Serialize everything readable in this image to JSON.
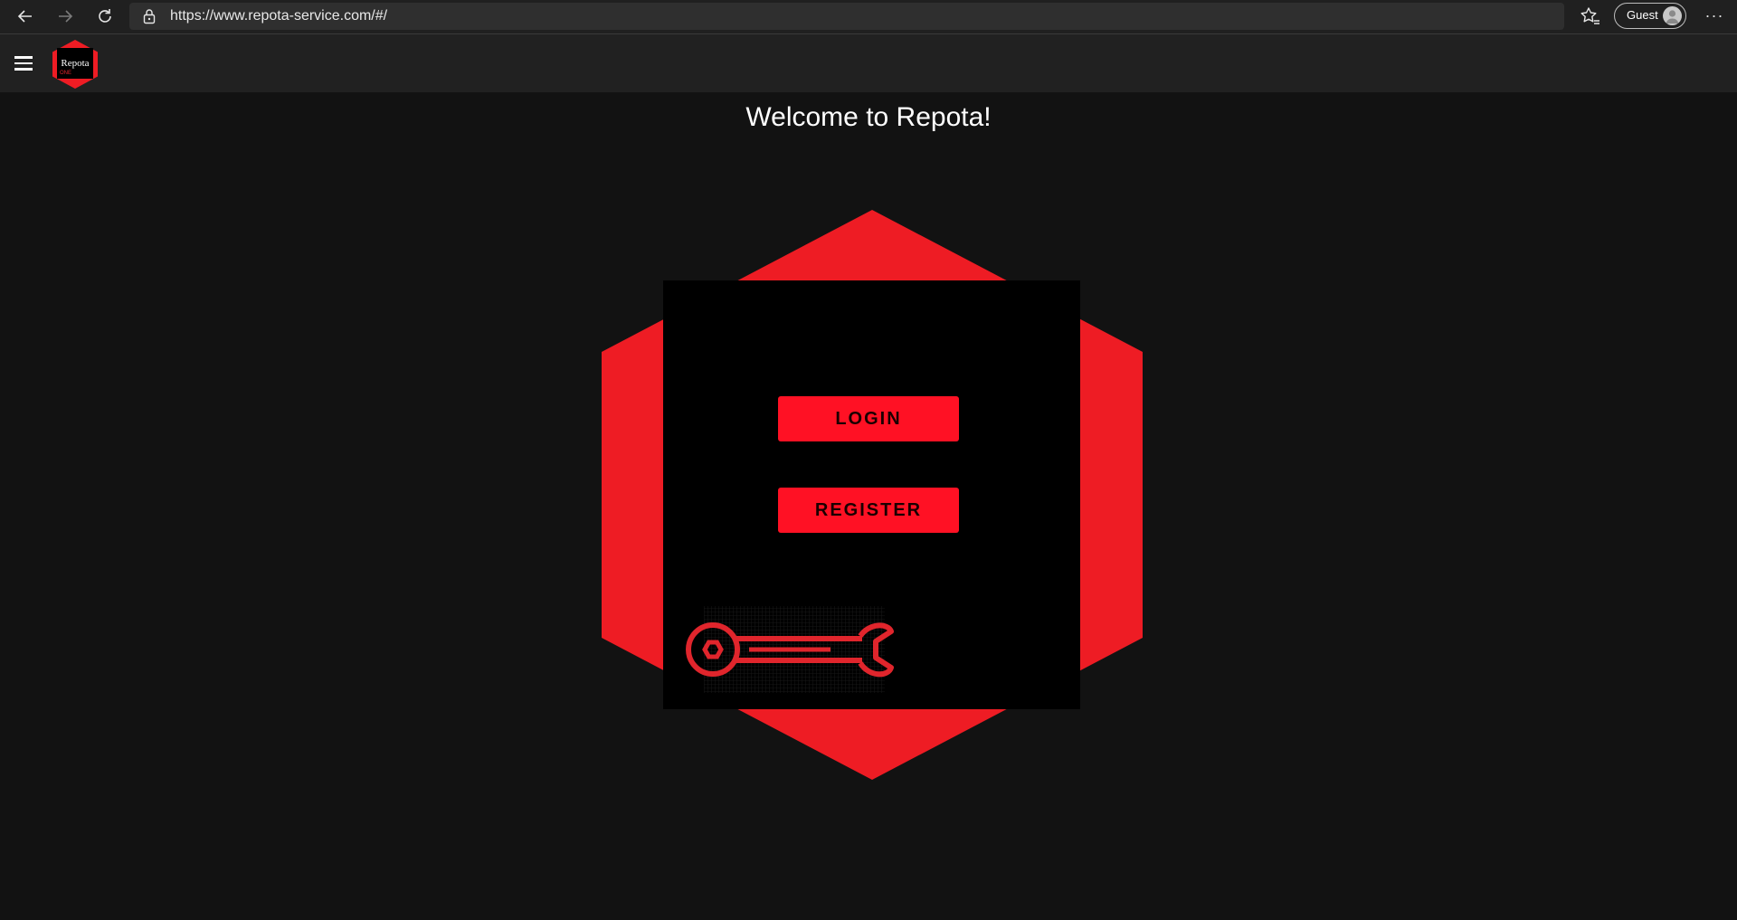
{
  "browser": {
    "url": "https://www.repota-service.com/#/",
    "profile_label": "Guest",
    "more_label": "···"
  },
  "app": {
    "logo_text": "Repota",
    "logo_subtext": "ONE"
  },
  "main": {
    "title": "Welcome to Repota!",
    "login_label": "LOGIN",
    "register_label": "REGISTER"
  },
  "colors": {
    "accent": "#ff1124",
    "hexagon": "#ee1c24",
    "page_bg": "#121212",
    "header_bg": "#212121",
    "panel_bg": "#000000"
  },
  "icons": {
    "back": "back-arrow-icon",
    "forward": "forward-arrow-icon",
    "reload": "reload-icon",
    "lock": "lock-icon",
    "favorites": "favorites-star-icon",
    "menu": "hamburger-menu-icon",
    "illustration": "wrench-icon"
  }
}
